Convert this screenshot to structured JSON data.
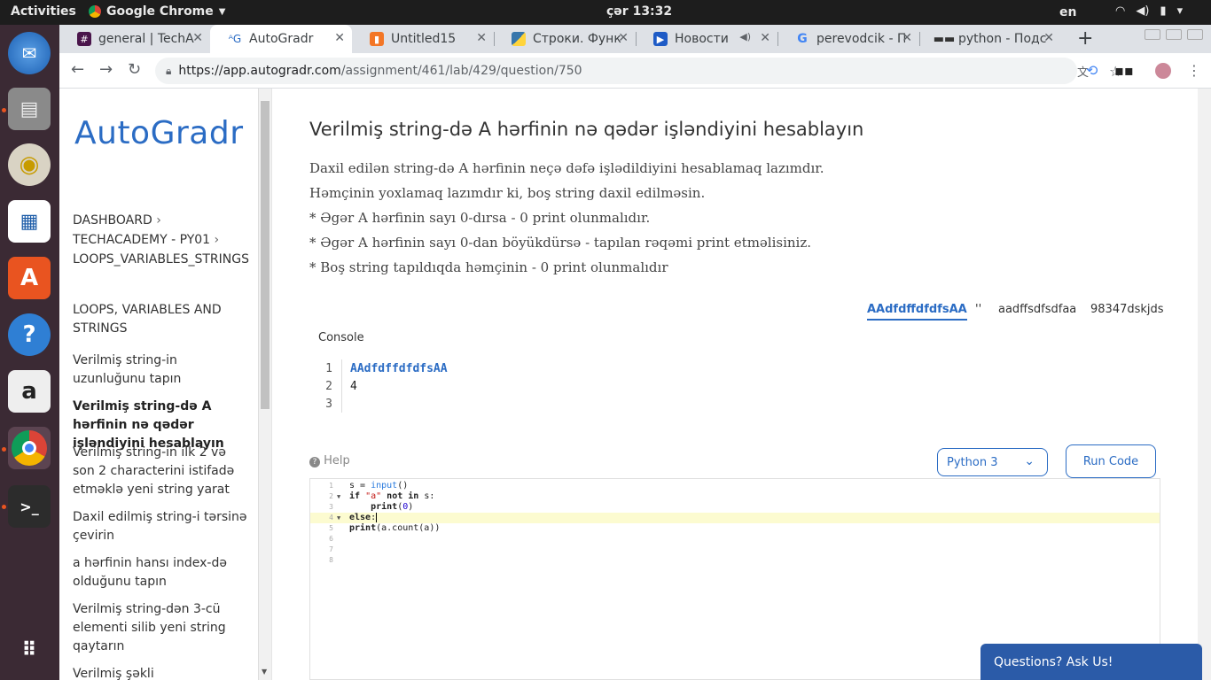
{
  "topbar": {
    "activities": "Activities",
    "app": "Google Chrome",
    "clock": "çər 13:32",
    "lang": "en"
  },
  "tabs": [
    {
      "label": "general | TechA",
      "icon": "slack-icon"
    },
    {
      "label": "AutoGradr",
      "icon": "autogradr-icon"
    },
    {
      "label": "Untitled15",
      "icon": "jupyter-icon"
    },
    {
      "label": "Строки. Функ",
      "icon": "python-icon"
    },
    {
      "label": "Новости",
      "icon": "video-icon"
    },
    {
      "label": "perevodcik - П",
      "icon": "google-icon"
    },
    {
      "label": "python - Подс",
      "icon": "glasses-icon"
    }
  ],
  "url": {
    "host": "https://app.autogradr.com",
    "path": "/assignment/461/lab/429/question/750"
  },
  "sidebar": {
    "logo": "AutoGradr",
    "breadcrumbs": [
      "DASHBOARD",
      "TECHACADEMY - PY01",
      "LOOPS_VARIABLES_STRINGS"
    ],
    "section_title": "LOOPS, VARIABLES AND STRINGS",
    "links": [
      "Verilmiş string-in uzunluğunu tapın",
      "Verilmiş string-də A hərfinin nə qədər işləndiyini hesablayın",
      "Verilmiş string-in ilk 2 və son 2 characterini istifadə etməklə yeni string yarat",
      "Daxil edilmiş string-i tərsinə çevirin",
      "a hərfinin hansı index-də olduğunu tapın",
      "Verilmiş string-dən 3-cü elementi silib yeni string qaytarın",
      "Verilmiş şəkli programlaşdırın"
    ]
  },
  "question": {
    "title": "Verilmiş string-də A hərfinin nə qədər işləndiyini hesablayın",
    "description": [
      "Daxil edilən string-də A hərfinin neçə dəfə işlədildiyini hesablamaq lazımdır.",
      "Həmçinin yoxlamaq lazımdır ki, boş string daxil edilməsin.",
      "* Əgər A hərfinin sayı 0-dırsa - 0 print olunmalıdır.",
      "* Əgər A hərfinin sayı 0-dan böyükdürsə - tapılan rəqəmi print etməlisiniz.",
      "* Boş string tapıldıqda həmçinin - 0 print olunmalıdır"
    ],
    "testcases": [
      "AAdfdffdfdfsAA",
      "''",
      "aadffsdfsdfaa",
      "98347dskjds"
    ]
  },
  "console": {
    "label": "Console",
    "lines": [
      "AAdfdffdfdfsAA",
      "4",
      ""
    ]
  },
  "editor": {
    "help": "Help",
    "language": "Python 3",
    "run_label": "Run Code",
    "lines": [
      "s = input()",
      "if \"a\" not in s:",
      "    print(0)",
      "else:",
      "print(a.count(a))",
      "",
      "",
      ""
    ]
  },
  "askus": "Questions? Ask Us!"
}
